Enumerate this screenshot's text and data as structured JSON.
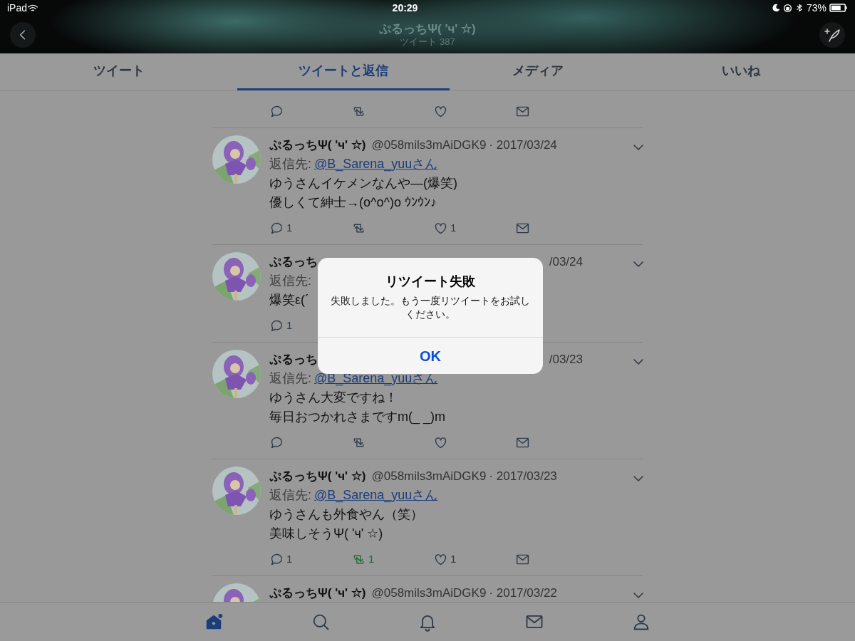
{
  "status_bar": {
    "carrier": "iPad",
    "time": "20:29",
    "battery": "73%"
  },
  "profile_header": {
    "title": "ぷるっちΨ( 'ч' ☆)",
    "subtitle": "ツイート 387"
  },
  "tabs": [
    {
      "label": "ツイート",
      "selected": false
    },
    {
      "label": "ツイートと返信",
      "selected": true
    },
    {
      "label": "メディア",
      "selected": false
    },
    {
      "label": "いいね",
      "selected": false
    }
  ],
  "tweets": [
    {
      "actions": [
        {
          "kind": "reply"
        },
        {
          "kind": "retweet",
          "active": false
        },
        {
          "kind": "like"
        },
        {
          "kind": "message"
        }
      ]
    },
    {
      "name": "ぷるっちΨ( 'ч' ☆)",
      "handle": "@058mils3mAiDGK9",
      "date": "· 2017/03/24",
      "reply_label": "返信先:",
      "reply_to": "@B_Sarena_yuuさん",
      "lines": [
        "ゆうさんイケメンなんや―(爆笑)",
        "優しくて紳士→(o^o^)o ｳﾝｳﾝ♪"
      ],
      "actions": [
        {
          "kind": "reply",
          "count": "1"
        },
        {
          "kind": "retweet",
          "active": false
        },
        {
          "kind": "like",
          "count": "1"
        },
        {
          "kind": "message"
        }
      ]
    },
    {
      "name": "ぷるっち",
      "date": "/03/24",
      "reply_label": "返信先:",
      "lines": [
        "爆笑ε(´"
      ],
      "actions": [
        {
          "kind": "reply",
          "count": "1"
        }
      ]
    },
    {
      "name": "ぷるっち",
      "date": "/03/23",
      "reply_label": "返信先:",
      "reply_to": "@B_Sarena_yuuさん",
      "lines": [
        "ゆうさん大変ですね！",
        "毎日おつかれさまですm(_ _)m"
      ],
      "actions": [
        {
          "kind": "reply"
        },
        {
          "kind": "retweet",
          "active": false
        },
        {
          "kind": "like"
        },
        {
          "kind": "message"
        }
      ]
    },
    {
      "name": "ぷるっちΨ( 'ч' ☆)",
      "handle": "@058mils3mAiDGK9",
      "date": "· 2017/03/23",
      "reply_label": "返信先:",
      "reply_to": "@B_Sarena_yuuさん",
      "lines": [
        "ゆうさんも外食やん（笑）",
        "美味しそうΨ( 'ч' ☆)"
      ],
      "actions": [
        {
          "kind": "reply",
          "count": "1"
        },
        {
          "kind": "retweet",
          "active": true,
          "count": "1"
        },
        {
          "kind": "like",
          "count": "1"
        },
        {
          "kind": "message"
        }
      ]
    },
    {
      "name": "ぷるっちΨ( 'ч' ☆)",
      "handle": "@058mils3mAiDGK9",
      "date": "· 2017/03/22"
    }
  ],
  "dialog": {
    "title": "リツイート失敗",
    "message": "失敗しました。もう一度リツイートをお試しください。",
    "button": "OK"
  },
  "tab_bar": [
    {
      "kind": "home",
      "selected": true
    },
    {
      "kind": "search",
      "selected": false
    },
    {
      "kind": "notifications",
      "selected": false
    },
    {
      "kind": "messages",
      "selected": false
    },
    {
      "kind": "profile",
      "selected": false
    }
  ]
}
